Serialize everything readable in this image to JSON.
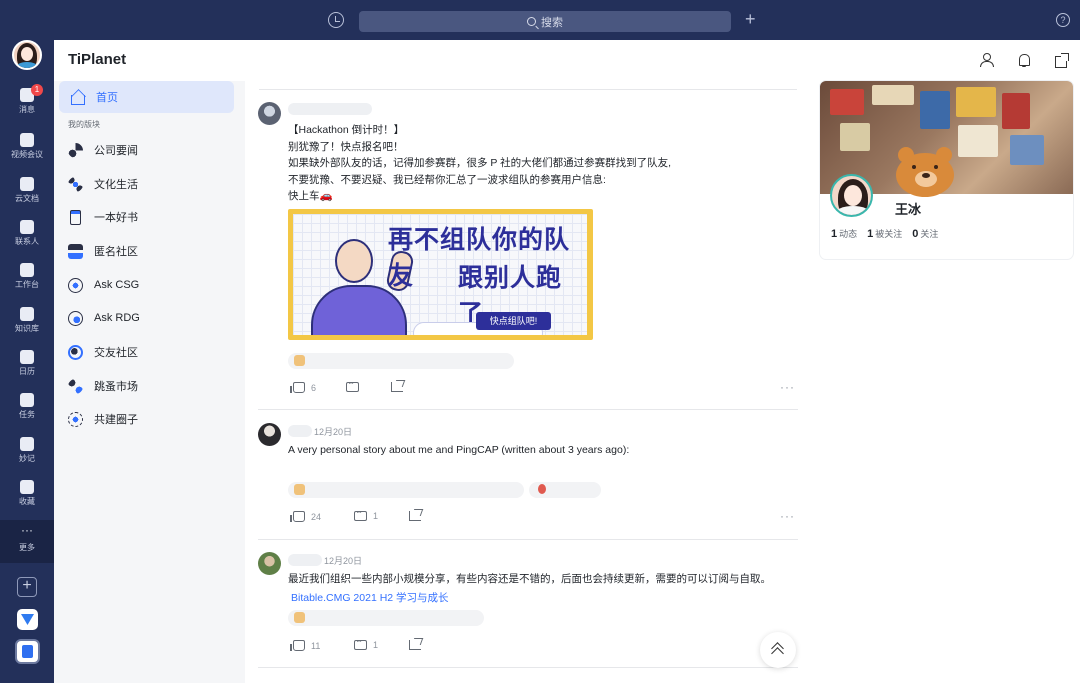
{
  "titlebar": {
    "search_placeholder": "搜索"
  },
  "leftnav": {
    "badge": "1",
    "items": [
      {
        "label": "消息"
      },
      {
        "label": "视频会议"
      },
      {
        "label": "云文档"
      },
      {
        "label": "联系人"
      },
      {
        "label": "工作台"
      },
      {
        "label": "知识库"
      },
      {
        "label": "日历"
      },
      {
        "label": "任务"
      },
      {
        "label": "妙记"
      },
      {
        "label": "收藏"
      },
      {
        "label": "更多"
      }
    ]
  },
  "header": {
    "title": "TiPlanet"
  },
  "sidebar": {
    "home": "首页",
    "section": "我的版块",
    "items": [
      {
        "label": "公司要闻",
        "icon": "rss-icon"
      },
      {
        "label": "文化生活",
        "icon": "culture-icon"
      },
      {
        "label": "一本好书",
        "icon": "book-icon"
      },
      {
        "label": "匿名社区",
        "icon": "anonymous-icon"
      },
      {
        "label": "Ask CSG",
        "icon": "ask-csg-icon"
      },
      {
        "label": "Ask RDG",
        "icon": "ask-rdg-icon"
      },
      {
        "label": "交友社区",
        "icon": "social-icon"
      },
      {
        "label": "跳蚤市场",
        "icon": "market-icon"
      },
      {
        "label": "共建圈子",
        "icon": "circle-icon"
      }
    ]
  },
  "posts": [
    {
      "lines": [
        "【Hackathon 倒计时！】",
        "别犹豫了！快点报名吧！",
        "如果缺外部队友的话，记得加参赛群，很多 P 社的大佬们都通过参赛群找到了队友,",
        "不要犹豫、不要迟疑、我已经帮你汇总了一波求组队的参赛用户信息:",
        "快上车🚗"
      ],
      "banner": {
        "line1": "再不组队你的队友",
        "line2": "跟别人跑了",
        "cta": "快点组队吧!"
      },
      "likes": "6",
      "comments": ""
    },
    {
      "date": "12月20日",
      "lines": [
        "A very personal story about me and PingCAP (written about 3 years ago):"
      ],
      "likes": "24",
      "comments": "1"
    },
    {
      "date": "12月20日",
      "lines": [
        "最近我们组织一些内部小规模分享，有些内容还是不错的，后面也会持续更新，需要的可以订阅与自取。"
      ],
      "link": "Bitable.CMG 2021 H2 学习与成长",
      "likes": "11",
      "comments": "1"
    }
  ],
  "profile": {
    "name": "王冰",
    "stats": [
      {
        "value": "1",
        "label": "动态"
      },
      {
        "value": "1",
        "label": "被关注"
      },
      {
        "value": "0",
        "label": "关注"
      }
    ]
  }
}
